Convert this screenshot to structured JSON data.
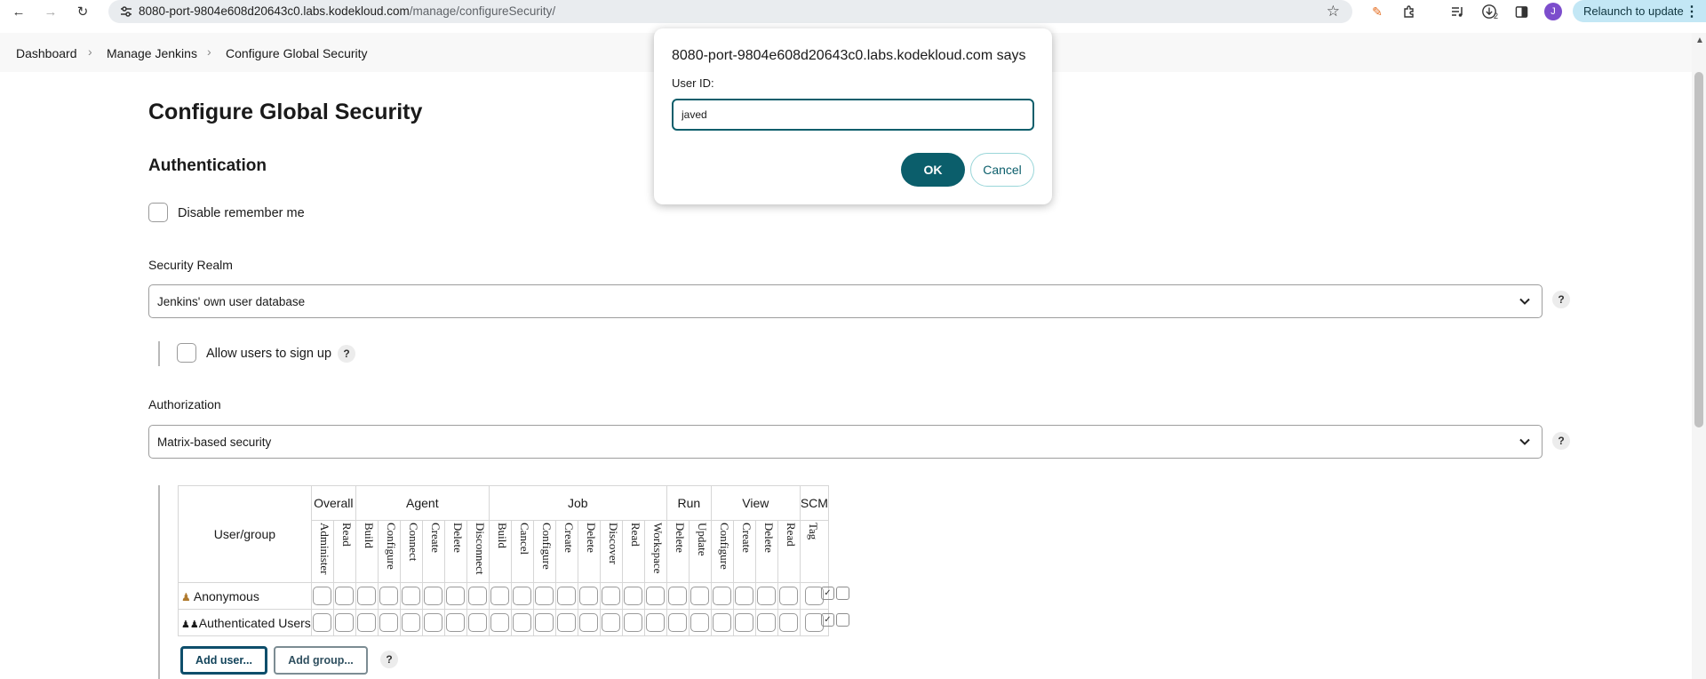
{
  "browser": {
    "url_host": "8080-port-9804e608d20643c0.labs.kodekloud.com",
    "url_path": "/manage/configureSecurity/",
    "download_badge": "2",
    "profile_initial": "J",
    "relaunch_label": "Relaunch to update"
  },
  "breadcrumb": [
    "Dashboard",
    "Manage Jenkins",
    "Configure Global Security"
  ],
  "page": {
    "title": "Configure Global Security",
    "authentication_heading": "Authentication",
    "disable_remember_me_label": "Disable remember me",
    "security_realm_label": "Security Realm",
    "security_realm_value": "Jenkins' own user database",
    "allow_signup_label": "Allow users to sign up",
    "authorization_label": "Authorization",
    "authorization_value": "Matrix-based security",
    "help_glyph": "?"
  },
  "matrix": {
    "user_group_header": "User/group",
    "groups": [
      "Overall",
      "Agent",
      "Job",
      "Run",
      "View",
      "SCM"
    ],
    "permissions": [
      "Administer",
      "Read",
      "Build",
      "Configure",
      "Connect",
      "Create",
      "Delete",
      "Disconnect",
      "Build",
      "Cancel",
      "Configure",
      "Create",
      "Delete",
      "Discover",
      "Read",
      "Workspace",
      "Delete",
      "Update",
      "Configure",
      "Create",
      "Delete",
      "Read",
      "Tag"
    ],
    "rows": [
      "Anonymous",
      "Authenticated Users"
    ],
    "add_user_label": "Add user...",
    "add_group_label": "Add group..."
  },
  "dialog": {
    "title": "8080-port-9804e608d20643c0.labs.kodekloud.com says",
    "label": "User ID:",
    "input_value": "javed",
    "ok_label": "OK",
    "cancel_label": "Cancel"
  }
}
